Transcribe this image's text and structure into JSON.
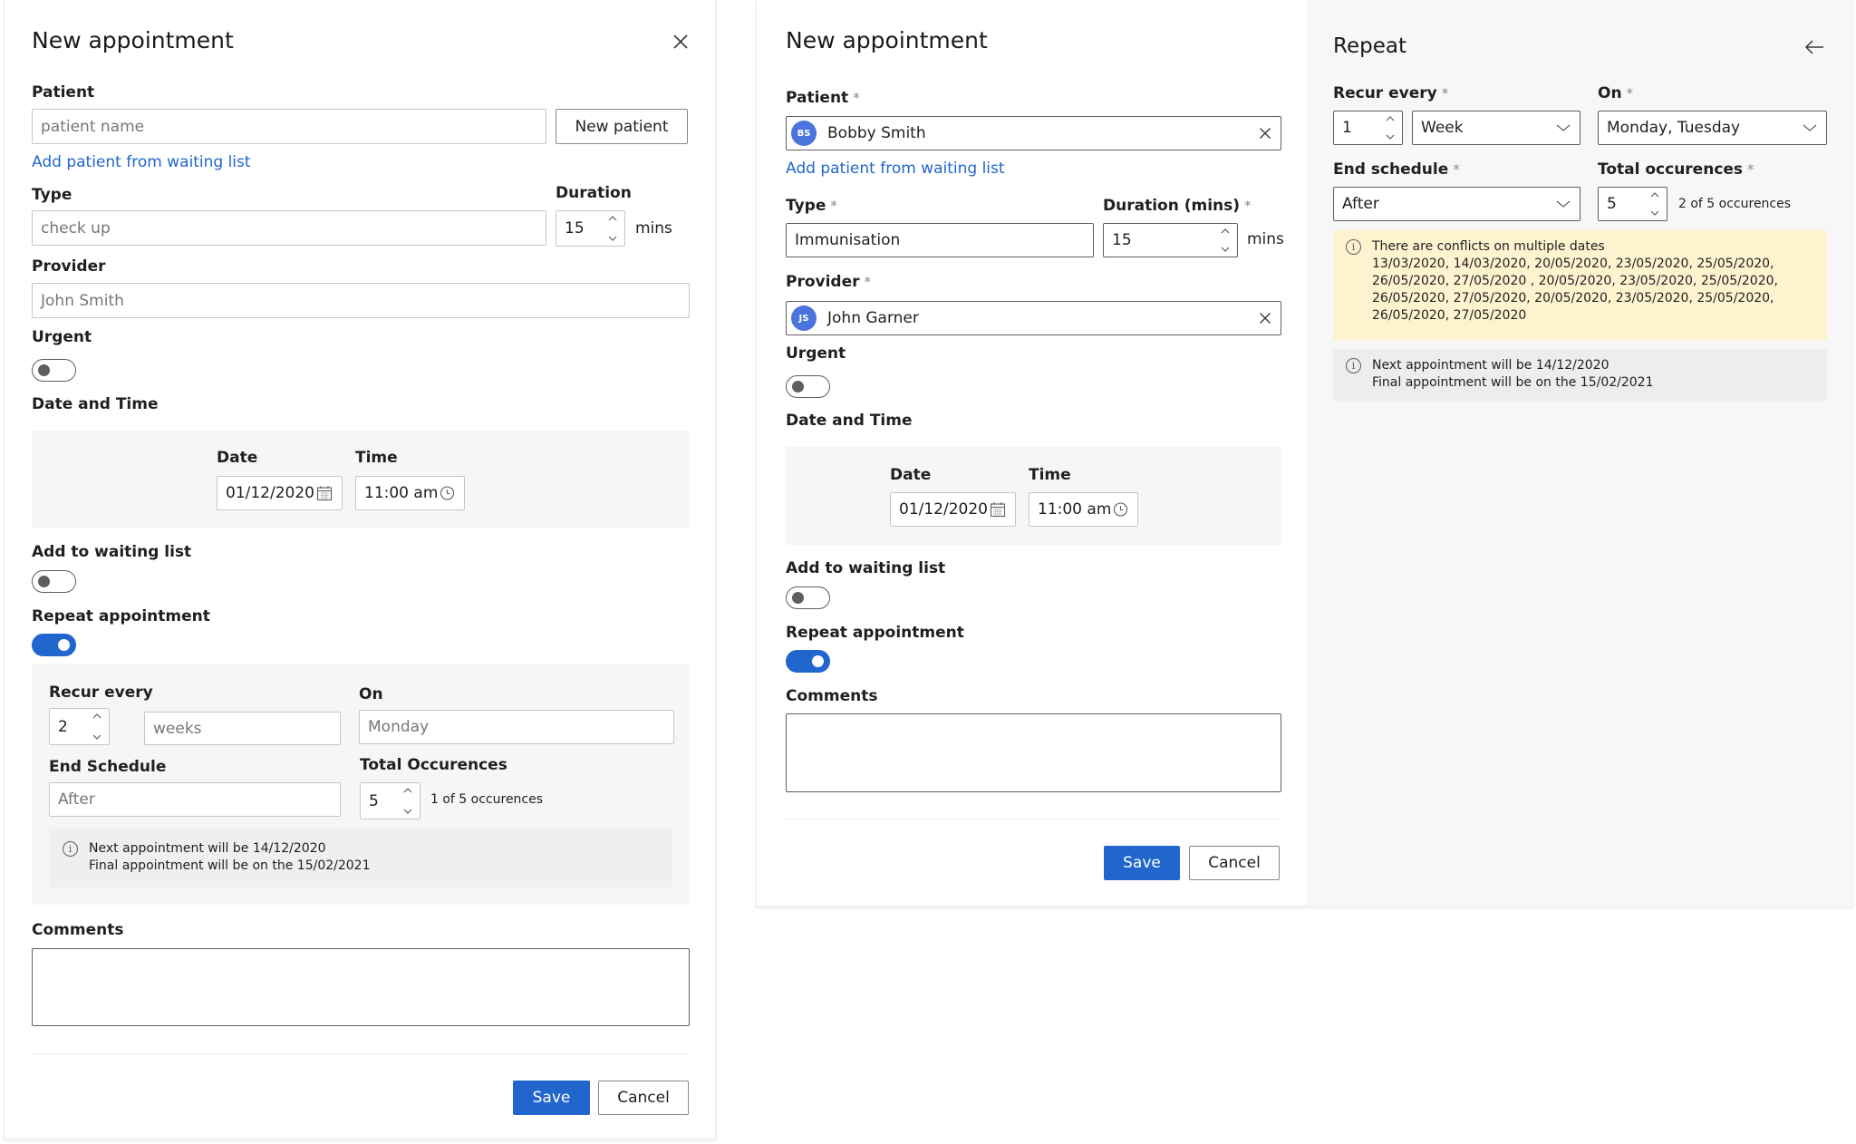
{
  "left_dialog": {
    "title": "New appointment",
    "patient": {
      "label": "Patient",
      "placeholder": "patient name",
      "new_patient_button": "New patient",
      "waiting_list_link": "Add patient from waiting list"
    },
    "type": {
      "label": "Type",
      "placeholder": "check up"
    },
    "duration": {
      "label": "Duration",
      "value": "15",
      "unit": "mins"
    },
    "provider": {
      "label": "Provider",
      "placeholder": "John Smith"
    },
    "urgent": {
      "label": "Urgent",
      "on": false
    },
    "date_time": {
      "label": "Date and Time",
      "date_label": "Date",
      "date_value": "01/12/2020",
      "time_label": "Time",
      "time_value": "11:00 am"
    },
    "waiting_list": {
      "label": "Add to waiting list",
      "on": false
    },
    "repeat": {
      "label": "Repeat appointment",
      "on": true,
      "recur_label": "Recur every",
      "recur_value": "2",
      "recur_unit_placeholder": "weeks",
      "on_label": "On",
      "on_placeholder": "Monday",
      "end_label": "End Schedule",
      "end_placeholder": "After",
      "total_label": "Total Occurences",
      "total_value": "5",
      "total_note": "1 of 5 occurences",
      "info_line1": "Next appointment will be 14/12/2020",
      "info_line2": "Final appointment will be on the 15/02/2021"
    },
    "comments": {
      "label": "Comments",
      "value": ""
    },
    "save_label": "Save",
    "cancel_label": "Cancel"
  },
  "right_dialog": {
    "title": "New appointment",
    "patient": {
      "label": "Patient",
      "required": "*",
      "initials": "BS",
      "value": "Bobby Smith",
      "waiting_list_link": "Add patient from waiting list"
    },
    "type": {
      "label": "Type",
      "required": "*",
      "value": "Immunisation"
    },
    "duration": {
      "label": "Duration (mins)",
      "required": "*",
      "value": "15",
      "unit": "mins"
    },
    "provider": {
      "label": "Provider",
      "required": "*",
      "initials": "JS",
      "value": "John Garner"
    },
    "urgent": {
      "label": "Urgent",
      "on": false
    },
    "date_time": {
      "label": "Date and Time",
      "date_label": "Date",
      "date_value": "01/12/2020",
      "time_label": "Time",
      "time_value": "11:00 am"
    },
    "waiting_list": {
      "label": "Add to waiting list",
      "on": false
    },
    "repeat": {
      "label": "Repeat appointment",
      "on": true
    },
    "comments": {
      "label": "Comments",
      "value": ""
    },
    "save_label": "Save",
    "cancel_label": "Cancel"
  },
  "repeat_panel": {
    "title": "Repeat",
    "recur_label": "Recur every",
    "recur_required": "*",
    "recur_value": "1",
    "recur_unit": "Week",
    "on_label": "On",
    "on_required": "*",
    "on_value": "Monday, Tuesday",
    "end_label": "End schedule",
    "end_required": "*",
    "end_value": "After",
    "total_label": "Total occurences",
    "total_required": "*",
    "total_value": "5",
    "total_note": "2 of 5 occurences",
    "warning_title": "There are conflicts on multiple dates",
    "warning_lines": [
      "13/03/2020, 14/03/2020, 20/05/2020, 23/05/2020, 25/05/2020,",
      "26/05/2020, 27/05/2020 , 20/05/2020, 23/05/2020, 25/05/2020,",
      "26/05/2020, 27/05/2020, 20/05/2020, 23/05/2020, 25/05/2020,",
      "26/05/2020, 27/05/2020"
    ],
    "info_line1": "Next appointment will be 14/12/2020",
    "info_line2": "Final appointment will be on the 15/02/2021"
  },
  "colors": {
    "primary": "#2166cc",
    "link": "#2266cc",
    "warning_bg": "#fdf3cf",
    "panel_gray": "#f6f6f6",
    "avatar": "#4b74dd"
  }
}
